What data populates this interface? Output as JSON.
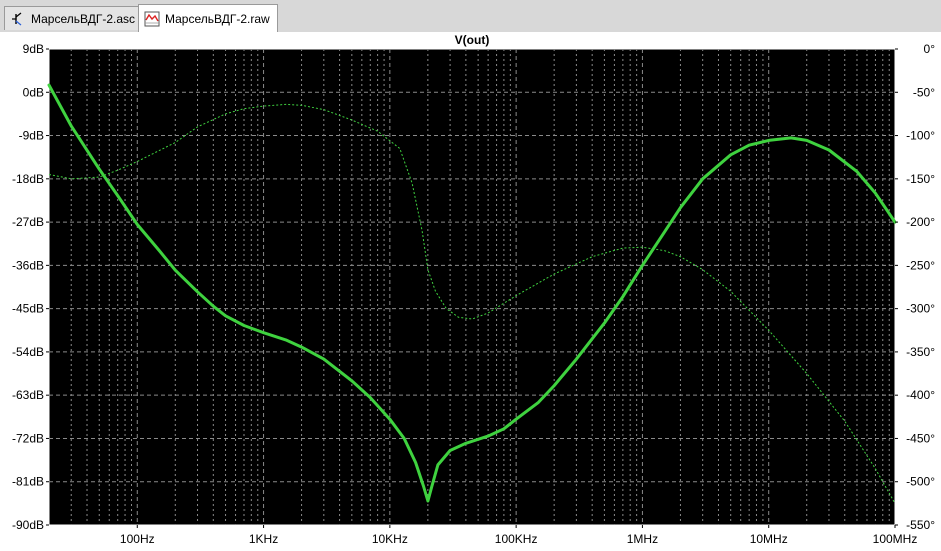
{
  "tabs": [
    {
      "label": "МарсельВДГ-2.asc",
      "icon": "schematic-icon"
    },
    {
      "label": "МарсельВДГ-2.raw",
      "icon": "waveform-icon"
    }
  ],
  "colors": {
    "background": "#000000",
    "grid": "#8a8a8a",
    "magnitude": "#3fd23f",
    "phase": "#3fd23f"
  },
  "chart_data": {
    "type": "line",
    "title": "V(out)",
    "x_scale": "log",
    "xlim": [
      20,
      100000000
    ],
    "x_ticks": [
      100,
      1000,
      10000,
      100000,
      1000000,
      10000000,
      100000000
    ],
    "x_tick_labels": [
      "100Hz",
      "1KHz",
      "10KHz",
      "100KHz",
      "1MHz",
      "10MHz",
      "100MHz"
    ],
    "left_axis": {
      "ylim": [
        -90,
        9
      ],
      "ticks": [
        9,
        0,
        -9,
        -18,
        -27,
        -36,
        -45,
        -54,
        -63,
        -72,
        -81,
        -90
      ],
      "tick_labels": [
        "9dB",
        "0dB",
        "-9dB",
        "-18dB",
        "-27dB",
        "-36dB",
        "-45dB",
        "-54dB",
        "-63dB",
        "-72dB",
        "-81dB",
        "-90dB"
      ]
    },
    "right_axis": {
      "ylim": [
        -550,
        0
      ],
      "ticks": [
        0,
        -50,
        -100,
        -150,
        -200,
        -250,
        -300,
        -350,
        -400,
        -450,
        -500,
        -550
      ],
      "tick_labels": [
        "0°",
        "-50°",
        "-100°",
        "-150°",
        "-200°",
        "-250°",
        "-300°",
        "-350°",
        "-400°",
        "-450°",
        "-500°",
        "-550°"
      ]
    },
    "grid": true,
    "series": [
      {
        "axis": "left",
        "style": "solid",
        "points": [
          [
            20,
            1.5
          ],
          [
            30,
            -7
          ],
          [
            50,
            -16
          ],
          [
            70,
            -21.5
          ],
          [
            100,
            -27.5
          ],
          [
            150,
            -33
          ],
          [
            200,
            -37
          ],
          [
            300,
            -41.5
          ],
          [
            400,
            -44.5
          ],
          [
            500,
            -46.5
          ],
          [
            700,
            -48.5
          ],
          [
            1000,
            -50
          ],
          [
            1500,
            -51.5
          ],
          [
            2000,
            -53
          ],
          [
            3000,
            -55.5
          ],
          [
            5000,
            -60
          ],
          [
            7000,
            -63.5
          ],
          [
            10000,
            -68
          ],
          [
            13000,
            -72
          ],
          [
            16000,
            -77
          ],
          [
            18500,
            -82
          ],
          [
            20000,
            -85
          ],
          [
            21500,
            -82
          ],
          [
            24000,
            -77.5
          ],
          [
            30000,
            -74.5
          ],
          [
            40000,
            -73
          ],
          [
            60000,
            -71.5
          ],
          [
            80000,
            -70
          ],
          [
            100000,
            -68
          ],
          [
            150000,
            -64.5
          ],
          [
            200000,
            -61
          ],
          [
            300000,
            -55.5
          ],
          [
            500000,
            -48
          ],
          [
            700000,
            -42.5
          ],
          [
            1000000,
            -36
          ],
          [
            1500000,
            -29
          ],
          [
            2000000,
            -24
          ],
          [
            3000000,
            -18
          ],
          [
            5000000,
            -13
          ],
          [
            7000000,
            -11
          ],
          [
            10000000,
            -10
          ],
          [
            15000000,
            -9.5
          ],
          [
            20000000,
            -10
          ],
          [
            30000000,
            -12
          ],
          [
            50000000,
            -16.5
          ],
          [
            70000000,
            -21
          ],
          [
            100000000,
            -27
          ]
        ]
      },
      {
        "axis": "right",
        "style": "dashed",
        "points": [
          [
            20,
            -145
          ],
          [
            30,
            -150
          ],
          [
            50,
            -148
          ],
          [
            70,
            -140
          ],
          [
            100,
            -130
          ],
          [
            200,
            -108
          ],
          [
            300,
            -90
          ],
          [
            500,
            -75
          ],
          [
            700,
            -69
          ],
          [
            1000,
            -66
          ],
          [
            1500,
            -64
          ],
          [
            2000,
            -65
          ],
          [
            3000,
            -70
          ],
          [
            5000,
            -82
          ],
          [
            8000,
            -95
          ],
          [
            12000,
            -115
          ],
          [
            15000,
            -155
          ],
          [
            18000,
            -210
          ],
          [
            20000,
            -255
          ],
          [
            23000,
            -280
          ],
          [
            28000,
            -300
          ],
          [
            35000,
            -310
          ],
          [
            45000,
            -312
          ],
          [
            60000,
            -305
          ],
          [
            100000,
            -285
          ],
          [
            200000,
            -260
          ],
          [
            400000,
            -240
          ],
          [
            700000,
            -230
          ],
          [
            1000000,
            -229
          ],
          [
            1500000,
            -233
          ],
          [
            2000000,
            -240
          ],
          [
            3000000,
            -255
          ],
          [
            5000000,
            -280
          ],
          [
            10000000,
            -325
          ],
          [
            20000000,
            -375
          ],
          [
            40000000,
            -430
          ],
          [
            70000000,
            -485
          ],
          [
            100000000,
            -525
          ]
        ]
      }
    ]
  }
}
